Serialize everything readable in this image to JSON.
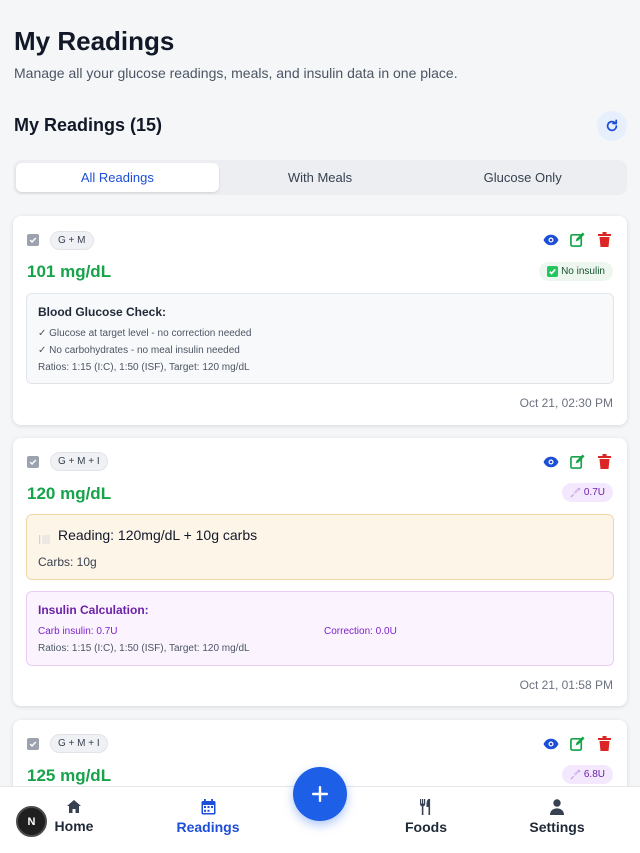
{
  "header": {
    "title": "My Readings",
    "subtitle": "Manage all your glucose readings, meals, and insulin data in one place."
  },
  "section": {
    "title": "My Readings (15)"
  },
  "tabs": [
    {
      "label": "All Readings",
      "active": true
    },
    {
      "label": "With Meals",
      "active": false
    },
    {
      "label": "Glucose Only",
      "active": false
    }
  ],
  "readings": [
    {
      "badge": "G + M",
      "glucose": "101 mg/dL",
      "status": {
        "icon": "check-icon",
        "label": "No insulin"
      },
      "box": {
        "title": "Blood Glucose Check:",
        "lines": [
          "✓ Glucose at target level - no correction needed",
          "✓ No carbohydrates - no meal insulin needed",
          "Ratios: 1:15 (I:C), 1:50 (ISF), Target: 120 mg/dL"
        ]
      },
      "timestamp": "Oct 21, 02:30 PM"
    },
    {
      "badge": "G + M + I",
      "glucose": "120 mg/dL",
      "status": {
        "icon": "syringe-icon",
        "label": "0.7U"
      },
      "meal": {
        "title": "Reading: 120mg/dL + 10g carbs",
        "carbs": "Carbs: 10g"
      },
      "insulin": {
        "title": "Insulin Calculation:",
        "carb": "Carb insulin: 0.7U",
        "correction": "Correction: 0.0U",
        "ratios": "Ratios: 1:15 (I:C), 1:50 (ISF), Target: 120 mg/dL"
      },
      "timestamp": "Oct 21, 01:58 PM"
    },
    {
      "badge": "G + M + I",
      "glucose": "125 mg/dL",
      "status": {
        "icon": "syringe-icon",
        "label": "6.8U"
      }
    }
  ],
  "nav": [
    {
      "label": "Home",
      "icon": "home-icon",
      "active": false
    },
    {
      "label": "Readings",
      "icon": "calendar-icon",
      "active": true
    },
    {
      "label": "Foods",
      "icon": "fork-knife-icon",
      "active": false
    },
    {
      "label": "Settings",
      "icon": "user-icon",
      "active": false
    }
  ],
  "avatar": {
    "initial": "N"
  },
  "colors": {
    "accent": "#1d5fe6",
    "glucose_green": "#16a34a",
    "view": "#1d4ed8",
    "edit": "#16a34a",
    "delete": "#dc2626"
  }
}
